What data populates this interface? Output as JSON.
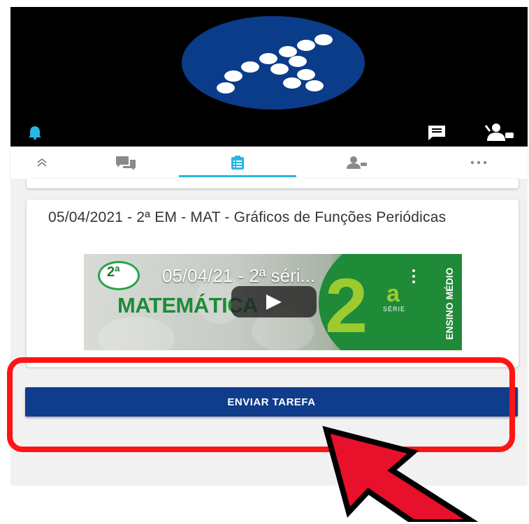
{
  "header": {
    "logo_icon": "dot-cluster-logo-icon",
    "notification_icon": "bell-icon",
    "message_icon": "message-icon",
    "support_icon": "support-agent-icon",
    "background_color": "#000000",
    "logo_color": "#0b3c8a"
  },
  "tabs": [
    {
      "icon": "collapse-chevron-icon",
      "active": false
    },
    {
      "icon": "chat-icon",
      "active": false
    },
    {
      "icon": "clipboard-icon",
      "active": true
    },
    {
      "icon": "person-icon",
      "active": false
    },
    {
      "icon": "more-horizontal-icon",
      "active": false
    }
  ],
  "card": {
    "title": "05/04/2021 - 2ª EM - MAT - Gráficos de Funções Periódicas",
    "video": {
      "badge": "2ª",
      "title": "05/04/21 - 2ª séri...",
      "subject": "MATEMÁTICA",
      "grade_number": "2",
      "grade_sup": "a",
      "grade_label": "SÉRIE",
      "level_label": "ENSINO MÉDIO"
    }
  },
  "actions": {
    "send_label": "ENVIAR TAREFA"
  },
  "colors": {
    "accent": "#29b6e6",
    "button": "#0f3d8c",
    "highlight": "#ff1414",
    "arrow": "#e8102a"
  }
}
